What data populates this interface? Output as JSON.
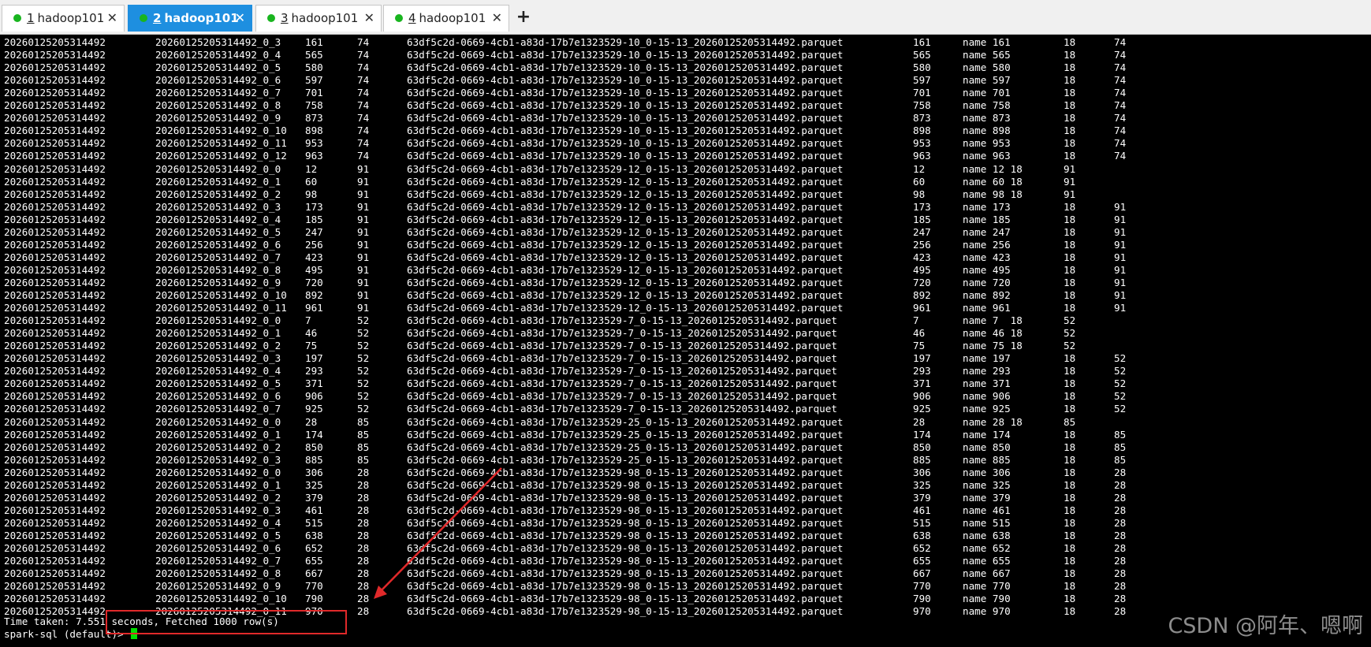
{
  "tabs": [
    {
      "num": "1",
      "label": "hadoop101",
      "active": false
    },
    {
      "num": "2",
      "label": "hadoop101",
      "active": true
    },
    {
      "num": "3",
      "label": "hadoop101",
      "active": false
    },
    {
      "num": "4",
      "label": "hadoop101",
      "active": false
    }
  ],
  "tab_close_glyph": "✕",
  "tab_add_glyph": "+",
  "colors": {
    "terminal_bg": "#000000",
    "terminal_text": "#ffffff",
    "active_tab": "#1e8fe0",
    "status_dot": "#19b51f",
    "cursor": "#00e000",
    "annotation": "#e0292a"
  },
  "rows": [
    [
      "20260125205314492",
      "20260125205314492_0_3",
      "161",
      "74",
      "63df5c2d-0669-4cb1-a83d-17b7e1323529-10_0-15-13_20260125205314492.parquet",
      "161",
      "name 161",
      "18",
      "74"
    ],
    [
      "20260125205314492",
      "20260125205314492_0_4",
      "565",
      "74",
      "63df5c2d-0669-4cb1-a83d-17b7e1323529-10_0-15-13_20260125205314492.parquet",
      "565",
      "name 565",
      "18",
      "74"
    ],
    [
      "20260125205314492",
      "20260125205314492_0_5",
      "580",
      "74",
      "63df5c2d-0669-4cb1-a83d-17b7e1323529-10_0-15-13_20260125205314492.parquet",
      "580",
      "name 580",
      "18",
      "74"
    ],
    [
      "20260125205314492",
      "20260125205314492_0_6",
      "597",
      "74",
      "63df5c2d-0669-4cb1-a83d-17b7e1323529-10_0-15-13_20260125205314492.parquet",
      "597",
      "name 597",
      "18",
      "74"
    ],
    [
      "20260125205314492",
      "20260125205314492_0_7",
      "701",
      "74",
      "63df5c2d-0669-4cb1-a83d-17b7e1323529-10_0-15-13_20260125205314492.parquet",
      "701",
      "name 701",
      "18",
      "74"
    ],
    [
      "20260125205314492",
      "20260125205314492_0_8",
      "758",
      "74",
      "63df5c2d-0669-4cb1-a83d-17b7e1323529-10_0-15-13_20260125205314492.parquet",
      "758",
      "name 758",
      "18",
      "74"
    ],
    [
      "20260125205314492",
      "20260125205314492_0_9",
      "873",
      "74",
      "63df5c2d-0669-4cb1-a83d-17b7e1323529-10_0-15-13_20260125205314492.parquet",
      "873",
      "name 873",
      "18",
      "74"
    ],
    [
      "20260125205314492",
      "20260125205314492_0_10",
      "898",
      "74",
      "63df5c2d-0669-4cb1-a83d-17b7e1323529-10_0-15-13_20260125205314492.parquet",
      "898",
      "name 898",
      "18",
      "74"
    ],
    [
      "20260125205314492",
      "20260125205314492_0_11",
      "953",
      "74",
      "63df5c2d-0669-4cb1-a83d-17b7e1323529-10_0-15-13_20260125205314492.parquet",
      "953",
      "name 953",
      "18",
      "74"
    ],
    [
      "20260125205314492",
      "20260125205314492_0_12",
      "963",
      "74",
      "63df5c2d-0669-4cb1-a83d-17b7e1323529-10_0-15-13_20260125205314492.parquet",
      "963",
      "name 963",
      "18",
      "74"
    ],
    [
      "20260125205314492",
      "20260125205314492_0_0",
      "12",
      "91",
      "63df5c2d-0669-4cb1-a83d-17b7e1323529-12_0-15-13_20260125205314492.parquet",
      "12",
      "name 12 18",
      "91",
      ""
    ],
    [
      "20260125205314492",
      "20260125205314492_0_1",
      "60",
      "91",
      "63df5c2d-0669-4cb1-a83d-17b7e1323529-12_0-15-13_20260125205314492.parquet",
      "60",
      "name 60 18",
      "91",
      ""
    ],
    [
      "20260125205314492",
      "20260125205314492_0_2",
      "98",
      "91",
      "63df5c2d-0669-4cb1-a83d-17b7e1323529-12_0-15-13_20260125205314492.parquet",
      "98",
      "name 98 18",
      "91",
      ""
    ],
    [
      "20260125205314492",
      "20260125205314492_0_3",
      "173",
      "91",
      "63df5c2d-0669-4cb1-a83d-17b7e1323529-12_0-15-13_20260125205314492.parquet",
      "173",
      "name 173",
      "18",
      "91"
    ],
    [
      "20260125205314492",
      "20260125205314492_0_4",
      "185",
      "91",
      "63df5c2d-0669-4cb1-a83d-17b7e1323529-12_0-15-13_20260125205314492.parquet",
      "185",
      "name 185",
      "18",
      "91"
    ],
    [
      "20260125205314492",
      "20260125205314492_0_5",
      "247",
      "91",
      "63df5c2d-0669-4cb1-a83d-17b7e1323529-12_0-15-13_20260125205314492.parquet",
      "247",
      "name 247",
      "18",
      "91"
    ],
    [
      "20260125205314492",
      "20260125205314492_0_6",
      "256",
      "91",
      "63df5c2d-0669-4cb1-a83d-17b7e1323529-12_0-15-13_20260125205314492.parquet",
      "256",
      "name 256",
      "18",
      "91"
    ],
    [
      "20260125205314492",
      "20260125205314492_0_7",
      "423",
      "91",
      "63df5c2d-0669-4cb1-a83d-17b7e1323529-12_0-15-13_20260125205314492.parquet",
      "423",
      "name 423",
      "18",
      "91"
    ],
    [
      "20260125205314492",
      "20260125205314492_0_8",
      "495",
      "91",
      "63df5c2d-0669-4cb1-a83d-17b7e1323529-12_0-15-13_20260125205314492.parquet",
      "495",
      "name 495",
      "18",
      "91"
    ],
    [
      "20260125205314492",
      "20260125205314492_0_9",
      "720",
      "91",
      "63df5c2d-0669-4cb1-a83d-17b7e1323529-12_0-15-13_20260125205314492.parquet",
      "720",
      "name 720",
      "18",
      "91"
    ],
    [
      "20260125205314492",
      "20260125205314492_0_10",
      "892",
      "91",
      "63df5c2d-0669-4cb1-a83d-17b7e1323529-12_0-15-13_20260125205314492.parquet",
      "892",
      "name 892",
      "18",
      "91"
    ],
    [
      "20260125205314492",
      "20260125205314492_0_11",
      "961",
      "91",
      "63df5c2d-0669-4cb1-a83d-17b7e1323529-12_0-15-13_20260125205314492.parquet",
      "961",
      "name 961",
      "18",
      "91"
    ],
    [
      "20260125205314492",
      "20260125205314492_0_0",
      "7",
      "52",
      "63df5c2d-0669-4cb1-a83d-17b7e1323529-7_0-15-13_20260125205314492.parquet",
      "7",
      "name 7  18",
      "52",
      ""
    ],
    [
      "20260125205314492",
      "20260125205314492_0_1",
      "46",
      "52",
      "63df5c2d-0669-4cb1-a83d-17b7e1323529-7_0-15-13_20260125205314492.parquet",
      "46",
      "name 46 18",
      "52",
      ""
    ],
    [
      "20260125205314492",
      "20260125205314492_0_2",
      "75",
      "52",
      "63df5c2d-0669-4cb1-a83d-17b7e1323529-7_0-15-13_20260125205314492.parquet",
      "75",
      "name 75 18",
      "52",
      ""
    ],
    [
      "20260125205314492",
      "20260125205314492_0_3",
      "197",
      "52",
      "63df5c2d-0669-4cb1-a83d-17b7e1323529-7_0-15-13_20260125205314492.parquet",
      "197",
      "name 197",
      "18",
      "52"
    ],
    [
      "20260125205314492",
      "20260125205314492_0_4",
      "293",
      "52",
      "63df5c2d-0669-4cb1-a83d-17b7e1323529-7_0-15-13_20260125205314492.parquet",
      "293",
      "name 293",
      "18",
      "52"
    ],
    [
      "20260125205314492",
      "20260125205314492_0_5",
      "371",
      "52",
      "63df5c2d-0669-4cb1-a83d-17b7e1323529-7_0-15-13_20260125205314492.parquet",
      "371",
      "name 371",
      "18",
      "52"
    ],
    [
      "20260125205314492",
      "20260125205314492_0_6",
      "906",
      "52",
      "63df5c2d-0669-4cb1-a83d-17b7e1323529-7_0-15-13_20260125205314492.parquet",
      "906",
      "name 906",
      "18",
      "52"
    ],
    [
      "20260125205314492",
      "20260125205314492_0_7",
      "925",
      "52",
      "63df5c2d-0669-4cb1-a83d-17b7e1323529-7_0-15-13_20260125205314492.parquet",
      "925",
      "name 925",
      "18",
      "52"
    ],
    [
      "20260125205314492",
      "20260125205314492_0_0",
      "28",
      "85",
      "63df5c2d-0669-4cb1-a83d-17b7e1323529-25_0-15-13_20260125205314492.parquet",
      "28",
      "name 28 18",
      "85",
      ""
    ],
    [
      "20260125205314492",
      "20260125205314492_0_1",
      "174",
      "85",
      "63df5c2d-0669-4cb1-a83d-17b7e1323529-25_0-15-13_20260125205314492.parquet",
      "174",
      "name 174",
      "18",
      "85"
    ],
    [
      "20260125205314492",
      "20260125205314492_0_2",
      "850",
      "85",
      "63df5c2d-0669-4cb1-a83d-17b7e1323529-25_0-15-13_20260125205314492.parquet",
      "850",
      "name 850",
      "18",
      "85"
    ],
    [
      "20260125205314492",
      "20260125205314492_0_3",
      "885",
      "85",
      "63df5c2d-0669-4cb1-a83d-17b7e1323529-25_0-15-13_20260125205314492.parquet",
      "885",
      "name 885",
      "18",
      "85"
    ],
    [
      "20260125205314492",
      "20260125205314492_0_0",
      "306",
      "28",
      "63df5c2d-0669-4cb1-a83d-17b7e1323529-98_0-15-13_20260125205314492.parquet",
      "306",
      "name 306",
      "18",
      "28"
    ],
    [
      "20260125205314492",
      "20260125205314492_0_1",
      "325",
      "28",
      "63df5c2d-0669-4cb1-a83d-17b7e1323529-98_0-15-13_20260125205314492.parquet",
      "325",
      "name 325",
      "18",
      "28"
    ],
    [
      "20260125205314492",
      "20260125205314492_0_2",
      "379",
      "28",
      "63df5c2d-0669-4cb1-a83d-17b7e1323529-98_0-15-13_20260125205314492.parquet",
      "379",
      "name 379",
      "18",
      "28"
    ],
    [
      "20260125205314492",
      "20260125205314492_0_3",
      "461",
      "28",
      "63df5c2d-0669-4cb1-a83d-17b7e1323529-98_0-15-13_20260125205314492.parquet",
      "461",
      "name 461",
      "18",
      "28"
    ],
    [
      "20260125205314492",
      "20260125205314492_0_4",
      "515",
      "28",
      "63df5c2d-0669-4cb1-a83d-17b7e1323529-98_0-15-13_20260125205314492.parquet",
      "515",
      "name 515",
      "18",
      "28"
    ],
    [
      "20260125205314492",
      "20260125205314492_0_5",
      "638",
      "28",
      "63df5c2d-0669-4cb1-a83d-17b7e1323529-98_0-15-13_20260125205314492.parquet",
      "638",
      "name 638",
      "18",
      "28"
    ],
    [
      "20260125205314492",
      "20260125205314492_0_6",
      "652",
      "28",
      "63df5c2d-0669-4cb1-a83d-17b7e1323529-98_0-15-13_20260125205314492.parquet",
      "652",
      "name 652",
      "18",
      "28"
    ],
    [
      "20260125205314492",
      "20260125205314492_0_7",
      "655",
      "28",
      "63df5c2d-0669-4cb1-a83d-17b7e1323529-98_0-15-13_20260125205314492.parquet",
      "655",
      "name 655",
      "18",
      "28"
    ],
    [
      "20260125205314492",
      "20260125205314492_0_8",
      "667",
      "28",
      "63df5c2d-0669-4cb1-a83d-17b7e1323529-98_0-15-13_20260125205314492.parquet",
      "667",
      "name 667",
      "18",
      "28"
    ],
    [
      "20260125205314492",
      "20260125205314492_0_9",
      "770",
      "28",
      "63df5c2d-0669-4cb1-a83d-17b7e1323529-98_0-15-13_20260125205314492.parquet",
      "770",
      "name 770",
      "18",
      "28"
    ],
    [
      "20260125205314492",
      "20260125205314492_0_10",
      "790",
      "28",
      "63df5c2d-0669-4cb1-a83d-17b7e1323529-98_0-15-13_20260125205314492.parquet",
      "790",
      "name 790",
      "18",
      "28"
    ],
    [
      "20260125205314492",
      "20260125205314492_0_11",
      "970",
      "28",
      "63df5c2d-0669-4cb1-a83d-17b7e1323529-98_0-15-13_20260125205314492.parquet",
      "970",
      "name 970",
      "18",
      "28"
    ]
  ],
  "time_taken_line": "Time taken: 7.551 seconds, Fetched 1000 row(s)",
  "prompt_line": "spark-sql (default)> ",
  "watermark": "CSDN @阿年、嗯啊"
}
